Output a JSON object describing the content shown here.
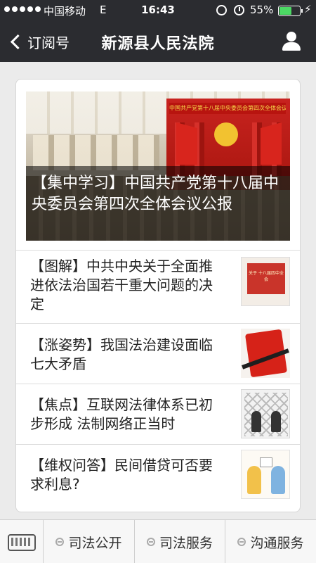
{
  "status_bar": {
    "carrier": "中国移动",
    "network": "E",
    "time": "16:43",
    "battery_percent": "55%",
    "battery_level": 0.55,
    "icons": [
      "signal-dots-icon",
      "orientation-lock-icon",
      "alarm-icon",
      "battery-icon",
      "charging-bolt-icon"
    ]
  },
  "nav": {
    "back_label": "订阅号",
    "title": "新源县人民法院",
    "back_icon": "chevron-left-icon",
    "profile_icon": "person-icon"
  },
  "hero": {
    "banner_text": "中国共产党第十八届中央委员会第四次全体会议",
    "caption": "【集中学习】中国共产党第十八届中央委员会第四次全体会议公报"
  },
  "articles": [
    {
      "title": "【图解】中共中央关于全面推进依法治国若干重大问题的决定",
      "thumb_text": "关于 十八届四中全会"
    },
    {
      "title": "【涨姿势】我国法治建设面临七大矛盾"
    },
    {
      "title": "【焦点】互联网法律体系已初步形成 法制网络正当时"
    },
    {
      "title": "【维权问答】民间借贷可否要求利息?"
    }
  ],
  "bottom_menu": {
    "keyboard_icon": "keyboard-icon",
    "items": [
      {
        "label": "司法公开"
      },
      {
        "label": "司法服务"
      },
      {
        "label": "沟通服务"
      }
    ]
  },
  "colors": {
    "bar_bg": "#2b2c30",
    "page_bg": "#ebebeb",
    "battery_fill": "#4cd964"
  }
}
